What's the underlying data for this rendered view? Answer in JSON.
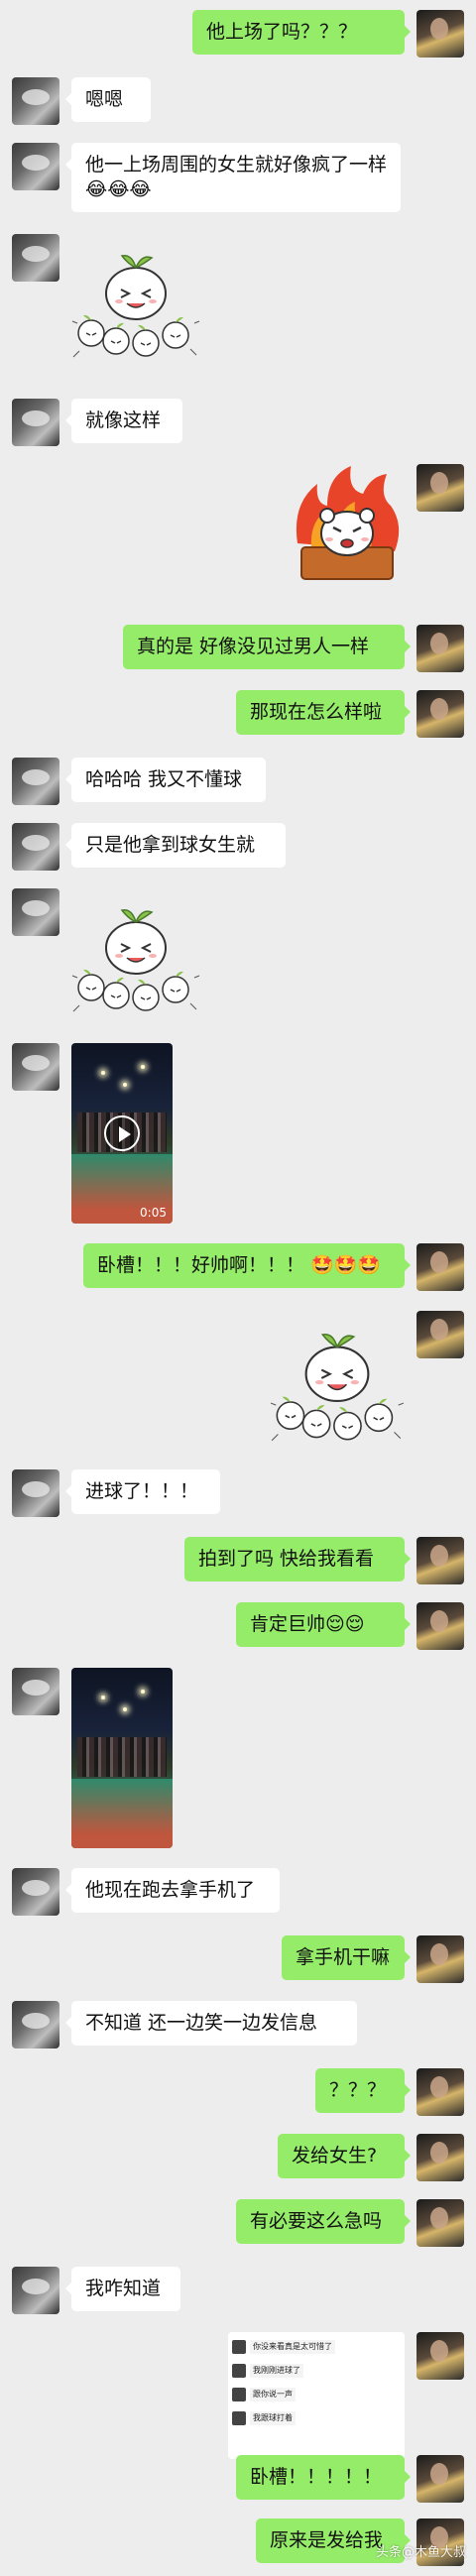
{
  "messages": [
    {
      "side": "right",
      "kind": "text",
      "text": "他上场了吗？？？"
    },
    {
      "side": "left",
      "kind": "text",
      "text": "嗯嗯"
    },
    {
      "side": "left",
      "kind": "text",
      "text": "他一上场周围的女生就好像疯了一样😂😂😂"
    },
    {
      "side": "left",
      "kind": "sticker",
      "sticker": "sprout-bun-laughing-crowd"
    },
    {
      "side": "left",
      "kind": "text",
      "text": "就像这样"
    },
    {
      "side": "right",
      "kind": "sticker",
      "sticker": "bear-flames-angry"
    },
    {
      "side": "right",
      "kind": "text",
      "text": "真的是  好像没见过男人一样"
    },
    {
      "side": "right",
      "kind": "text",
      "text": "那现在怎么样啦"
    },
    {
      "side": "left",
      "kind": "text",
      "text": "哈哈哈 我又不懂球"
    },
    {
      "side": "left",
      "kind": "text",
      "text": "只是他拿到球女生就"
    },
    {
      "side": "left",
      "kind": "sticker",
      "sticker": "sprout-bun-laughing-crowd"
    },
    {
      "side": "left",
      "kind": "video",
      "duration": "0:05"
    },
    {
      "side": "right",
      "kind": "text",
      "text": "卧槽！！！好帅啊！！！ 🤩🤩🤩"
    },
    {
      "side": "right",
      "kind": "sticker",
      "sticker": "sprout-bun-cheering"
    },
    {
      "side": "left",
      "kind": "text",
      "text": "进球了！！！"
    },
    {
      "side": "right",
      "kind": "text",
      "text": "拍到了吗  快给我看看"
    },
    {
      "side": "right",
      "kind": "text",
      "text": "肯定巨帅😌😌"
    },
    {
      "side": "left",
      "kind": "image",
      "image": "basketball-court-night-photo"
    },
    {
      "side": "left",
      "kind": "text",
      "text": "他现在跑去拿手机了"
    },
    {
      "side": "right",
      "kind": "text",
      "text": "拿手机干嘛"
    },
    {
      "side": "left",
      "kind": "text",
      "text": "不知道 还一边笑一边发信息"
    },
    {
      "side": "right",
      "kind": "text",
      "text": "？？？"
    },
    {
      "side": "right",
      "kind": "text",
      "text": "发给女生?"
    },
    {
      "side": "right",
      "kind": "text",
      "text": "有必要这么急吗"
    },
    {
      "side": "left",
      "kind": "text",
      "text": "我咋知道"
    },
    {
      "side": "right",
      "kind": "screenshot",
      "lines": [
        "你没来看真是太可惜了",
        "我刚刚进球了",
        "跟你说一声",
        "我跟球打着"
      ]
    },
    {
      "side": "right",
      "kind": "text",
      "text": "卧槽！！！！！"
    },
    {
      "side": "right",
      "kind": "text",
      "text": "原来是发给我"
    }
  ],
  "watermark": "头条@木鱼大叔",
  "colors": {
    "background": "#ededed",
    "self_bubble": "#95ec69",
    "other_bubble": "#ffffff"
  }
}
